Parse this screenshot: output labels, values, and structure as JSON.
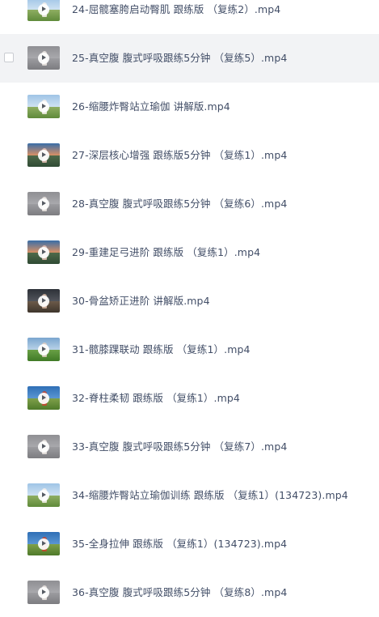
{
  "files": [
    {
      "name": "24-屈髋塞胯启动臀肌 跟练版 （复练2）.mp4",
      "thumb": "t-outdoor",
      "hovered": false
    },
    {
      "name": "25-真空腹 腹式呼吸跟练5分钟 （复练5）.mp4",
      "thumb": "t-studio",
      "hovered": true
    },
    {
      "name": "26-缩腰炸臀站立瑜伽 讲解版.mp4",
      "thumb": "t-outdoor",
      "hovered": false
    },
    {
      "name": "27-深层核心增强 跟练版5分钟 （复练1）.mp4",
      "thumb": "t-sunset",
      "hovered": false
    },
    {
      "name": "28-真空腹 腹式呼吸跟练5分钟 （复练6）.mp4",
      "thumb": "t-studio",
      "hovered": false
    },
    {
      "name": "29-重建足弓进阶 跟练版 （复练1）.mp4",
      "thumb": "t-sunset",
      "hovered": false
    },
    {
      "name": "30-骨盆矫正进阶 讲解版.mp4",
      "thumb": "t-dark",
      "hovered": false
    },
    {
      "name": "31-髋膝踝联动 跟练版 （复练1）.mp4",
      "thumb": "t-field",
      "hovered": false
    },
    {
      "name": "32-脊柱柔韧 跟练版 （复练1）.mp4",
      "thumb": "t-banner",
      "hovered": false
    },
    {
      "name": "33-真空腹 腹式呼吸跟练5分钟 （复练7）.mp4",
      "thumb": "t-studio",
      "hovered": false
    },
    {
      "name": "34-缩腰炸臀站立瑜伽训练 跟练版 （复练1）(134723).mp4",
      "thumb": "t-outdoor",
      "hovered": false
    },
    {
      "name": "35-全身拉伸 跟练版 （复练1）(134723).mp4",
      "thumb": "t-banner",
      "hovered": false
    },
    {
      "name": "36-真空腹 腹式呼吸跟练5分钟 （复练8）.mp4",
      "thumb": "t-studio",
      "hovered": false
    }
  ]
}
